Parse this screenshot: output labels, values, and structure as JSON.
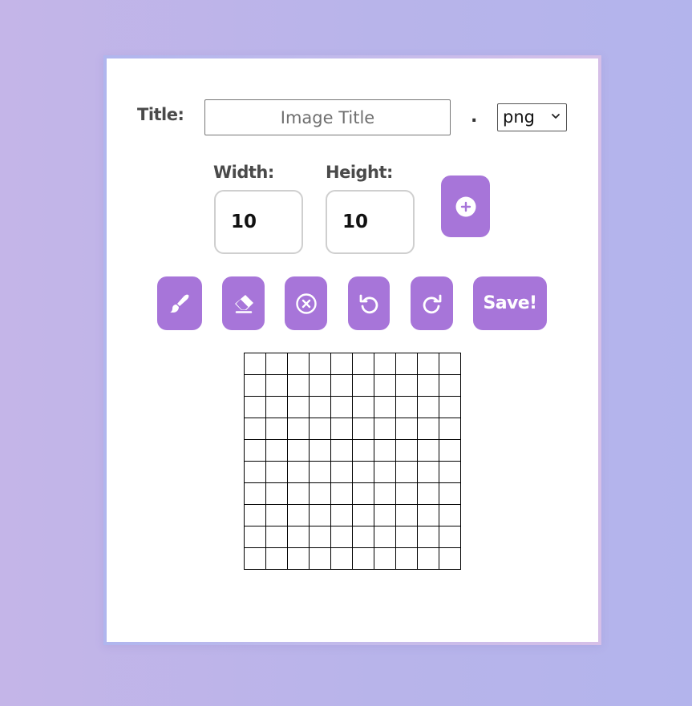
{
  "form": {
    "title_label": "Title:",
    "title_placeholder": "Image Title",
    "title_value": "",
    "dot": ".",
    "format_selected": "png",
    "width_label": "Width:",
    "width_value": "10",
    "height_label": "Height:",
    "height_value": "10"
  },
  "toolbar": {
    "add_icon": "plus-circle-icon",
    "brush_icon": "paintbrush-icon",
    "eraser_icon": "eraser-icon",
    "clear_icon": "x-circle-icon",
    "undo_icon": "undo-icon",
    "redo_icon": "redo-icon",
    "save_label": "Save!"
  },
  "canvas": {
    "columns": 10,
    "rows": 10
  },
  "colors": {
    "accent": "#a775d9",
    "background_start": "#c4b5e8",
    "background_end": "#b3b4ec",
    "card": "#ffffff",
    "cell_border": "#000000"
  }
}
